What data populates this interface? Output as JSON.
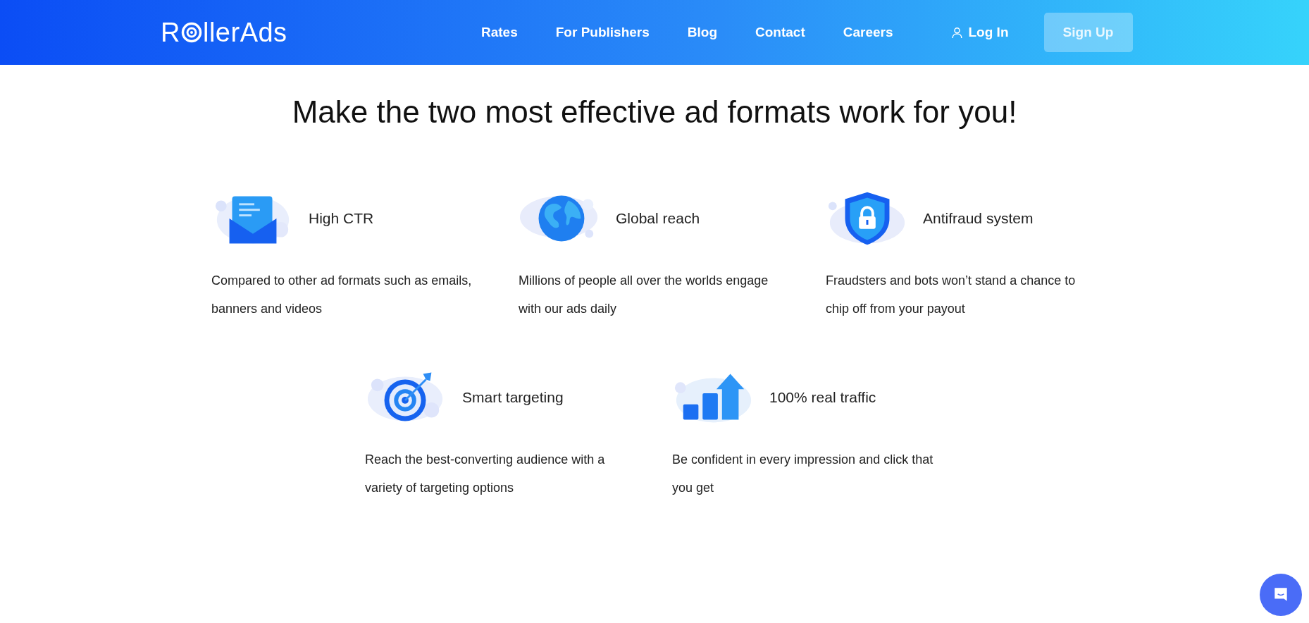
{
  "header": {
    "logo": {
      "before": "R",
      "after": "llerAds"
    },
    "nav": [
      {
        "label": "Rates"
      },
      {
        "label": "For Publishers"
      },
      {
        "label": "Blog"
      },
      {
        "label": "Contact"
      },
      {
        "label": "Careers"
      }
    ],
    "login": "Log In",
    "signup": "Sign Up"
  },
  "title": "Make the two most effective ad formats work for you!",
  "features": [
    {
      "kind": "envelope",
      "title": "High CTR",
      "text": "Compared to other ad formats such as emails, banners and videos"
    },
    {
      "kind": "globe",
      "title": "Global reach",
      "text": "Millions of people all over the worlds engage with our ads daily"
    },
    {
      "kind": "shield",
      "title": "Antifraud system",
      "text": "Fraudsters and bots won’t stand a chance to chip off from your payout"
    },
    {
      "kind": "target",
      "title": "Smart targeting",
      "text": "Reach the best-converting audience with a variety of targeting options"
    },
    {
      "kind": "chart",
      "title": "100% real traffic",
      "text": "Be confident in every impression and click that you get"
    }
  ]
}
